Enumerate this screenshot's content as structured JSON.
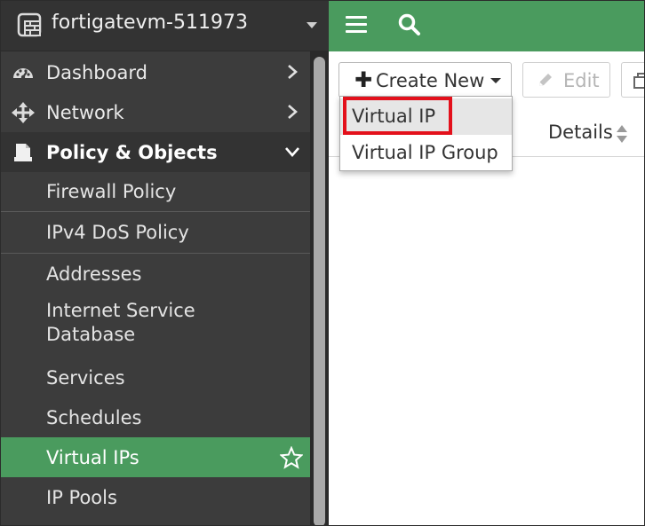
{
  "device": {
    "name": "fortigatevm-511973"
  },
  "sidebar": {
    "items": [
      {
        "label": "Dashboard",
        "icon": "dashboard-icon",
        "chevron": "right"
      },
      {
        "label": "Network",
        "icon": "move-arrows-icon",
        "chevron": "right"
      },
      {
        "label": "Policy & Objects",
        "icon": "policy-document-icon",
        "chevron": "down",
        "expanded": true
      }
    ],
    "subitems": [
      {
        "label": "Firewall Policy"
      },
      {
        "label": "IPv4 DoS Policy"
      },
      {
        "label": "Addresses"
      },
      {
        "label": "Internet Service Database"
      },
      {
        "label": "Services"
      },
      {
        "label": "Schedules"
      },
      {
        "label": "Virtual IPs",
        "active": true,
        "favorite_icon": "star-icon"
      },
      {
        "label": "IP Pools"
      }
    ]
  },
  "topbar": {
    "menu_icon": "hamburger-icon",
    "search_icon": "search-icon"
  },
  "toolbar": {
    "create_new_label": "Create New",
    "edit_label": "Edit",
    "clone_icon": "clone-icon"
  },
  "table": {
    "columns": [
      "Details"
    ]
  },
  "create_menu": {
    "options": [
      "Virtual IP",
      "Virtual IP Group"
    ],
    "highlighted": "Virtual IP"
  },
  "colors": {
    "accent_green": "#4a9b5e",
    "sidebar_bg": "#3c3c3c",
    "highlight_red": "#e3101b"
  }
}
